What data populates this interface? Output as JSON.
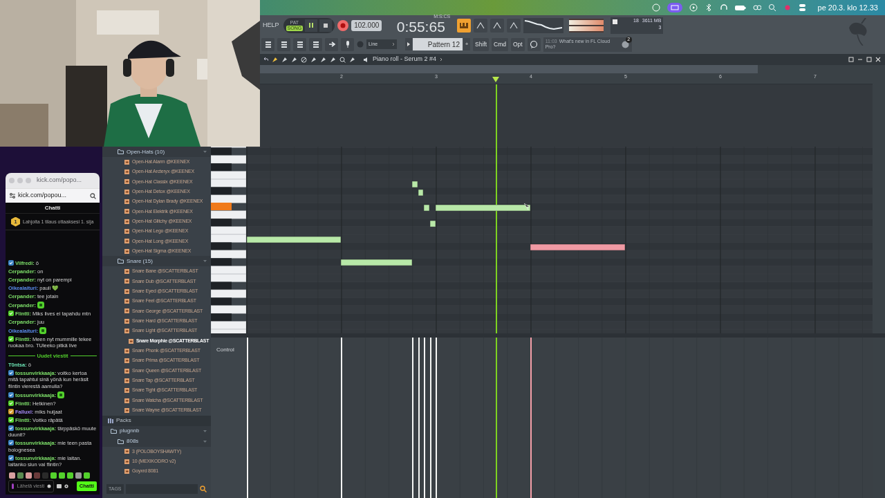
{
  "menubar": {
    "clock": "pe 20.3. klo 12.33"
  },
  "toolbar": {
    "help": "HELP",
    "modes": [
      {
        "label": "PAT",
        "selected": false
      },
      {
        "label": "SONG",
        "selected": true
      }
    ],
    "tempo": "102.000",
    "time": "0:55:65",
    "time_format": "M:S:CS",
    "cpu": "18",
    "memory": "3611 MB",
    "voices": "3",
    "snap": "Line",
    "pattern": "Pattern 12",
    "add": "+",
    "keys": [
      "Shift",
      "Cmd",
      "Opt"
    ],
    "news_time": "11:03",
    "news": "What's new in FL Cloud Pro?",
    "news_badge": "2"
  },
  "browser": {
    "tree": [
      {
        "kind": "folder",
        "label": "Open-Hats (10)",
        "expanded": true,
        "children": [
          {
            "kind": "file",
            "label": "Open-Hat Alarm @KEENEX",
            "selected": false
          },
          {
            "kind": "file",
            "label": "Open-Hat Arcteryx @KEENEX",
            "selected": false
          },
          {
            "kind": "file",
            "label": "Open-Hat Classix @KEENEX",
            "selected": false
          },
          {
            "kind": "file",
            "label": "Open-Hat Detox @KEENEX",
            "selected": false
          },
          {
            "kind": "file",
            "label": "Open-Hat Dylan Brady @KEENEX",
            "selected": false
          },
          {
            "kind": "file",
            "label": "Open-Hat Elektrik @KEENEX",
            "selected": false
          },
          {
            "kind": "file",
            "label": "Open-Hat Glitchy @KEENEX",
            "selected": false
          },
          {
            "kind": "file",
            "label": "Open-Hat Lego @KEENEX",
            "selected": false
          },
          {
            "kind": "file",
            "label": "Open-Hat Long @KEENEX",
            "selected": false
          },
          {
            "kind": "file",
            "label": "Open-Hat Sigma @KEENEX",
            "selected": false
          }
        ]
      },
      {
        "kind": "folder",
        "label": "Snare (15)",
        "expanded": true,
        "children": [
          {
            "kind": "file",
            "label": "Snare Bane  @SCATTERBLAST",
            "selected": false
          },
          {
            "kind": "file",
            "label": "Snare Dub  @SCATTERBLAST",
            "selected": false
          },
          {
            "kind": "file",
            "label": "Snare Eyed  @SCATTERBLAST",
            "selected": false
          },
          {
            "kind": "file",
            "label": "Snare Feel  @SCATTERBLAST",
            "selected": false
          },
          {
            "kind": "file",
            "label": "Snare George  @SCATTERBLAST",
            "selected": false
          },
          {
            "kind": "file",
            "label": "Snare Hard  @SCATTERBLAST",
            "selected": false
          },
          {
            "kind": "file",
            "label": "Snare Light  @SCATTERBLAST",
            "selected": false
          },
          {
            "kind": "file",
            "label": "Snare Morphie  @SCATTERBLAST",
            "selected": true
          },
          {
            "kind": "file",
            "label": "Snare Phonk  @SCATTERBLAST",
            "selected": false
          },
          {
            "kind": "file",
            "label": "Snare Prima  @SCATTERBLAST",
            "selected": false
          },
          {
            "kind": "file",
            "label": "Snare Queen  @SCATTERBLAST",
            "selected": false
          },
          {
            "kind": "file",
            "label": "Snare Tap  @SCATTERBLAST",
            "selected": false
          },
          {
            "kind": "file",
            "label": "Snare Tight  @SCATTERBLAST",
            "selected": false
          },
          {
            "kind": "file",
            "label": "Snare Watcha  @SCATTERBLAST",
            "selected": false
          },
          {
            "kind": "file",
            "label": "Snare Wayne  @SCATTERBLAST",
            "selected": false
          }
        ]
      },
      {
        "kind": "section",
        "label": "Packs",
        "children": [
          {
            "kind": "folder",
            "label": "plugnnb",
            "expanded": true,
            "children": [
              {
                "kind": "folder",
                "label": "808s",
                "expanded": true,
                "children": [
                  {
                    "kind": "file",
                    "label": "3 (POLOBOYSHAWTY)",
                    "selected": false
                  },
                  {
                    "kind": "file",
                    "label": "10 (MEXIKODRO v2)",
                    "selected": false
                  },
                  {
                    "kind": "file",
                    "label": "Goyxrd 8081",
                    "selected": false
                  }
                ]
              }
            ]
          }
        ]
      }
    ],
    "tags": "TAGS"
  },
  "piano_roll": {
    "title": "Piano roll - Serum 2 #4",
    "bars": [
      "2",
      "3",
      "4",
      "5",
      "6",
      "7"
    ],
    "control_label": "Control"
  },
  "chat": {
    "tab_title": "kick.com/popo...",
    "url": "kick.com/popou...",
    "header": "Chatti",
    "pinned_rank": "1",
    "pinned": "Lahjoita 1 tilaus ottaaksesi 1. sija",
    "messages": [
      {
        "kind": "message",
        "badge": {
          "color": "#3b82c4"
        },
        "user": "Vilfredi:",
        "color": "#7ee06a",
        "text": "ö"
      },
      {
        "kind": "message",
        "user": "Cerpander:",
        "color": "#7ee06a",
        "text": "on"
      },
      {
        "kind": "message",
        "user": "Cerpander:",
        "color": "#7ee06a",
        "text": "nyt on parempi"
      },
      {
        "kind": "message",
        "user": "Oikealaituri:",
        "color": "#5b8def",
        "text": "pauli 💚"
      },
      {
        "kind": "message",
        "user": "Cerpander:",
        "color": "#7ee06a",
        "text": "tee jotain"
      },
      {
        "kind": "emote",
        "user": "Cerpander:",
        "color": "#7ee06a"
      },
      {
        "kind": "message",
        "badge": {
          "color": "#53d12c"
        },
        "user": "Flintti:",
        "color": "#7ee06a",
        "text": "Miks lives ei tapahdu mtn"
      },
      {
        "kind": "message",
        "user": "Cerpander:",
        "color": "#7ee06a",
        "text": "juu"
      },
      {
        "kind": "emote",
        "user": "Oikealaituri:",
        "color": "#5b8def"
      },
      {
        "kind": "message",
        "badge": {
          "color": "#53d12c"
        },
        "user": "Flintti:",
        "color": "#7ee06a",
        "text": "Meen nyt mummille tekee ruokaa bro. TUleeko pitkä live"
      },
      {
        "kind": "divider",
        "text": "Uudet viestit"
      },
      {
        "kind": "message",
        "user": "T0ntsa:",
        "color": "#6ee7b7",
        "text": "ö"
      },
      {
        "kind": "message",
        "badge": {
          "color": "#3b82c4"
        },
        "user": "tossunvirkkaaja:",
        "color": "#7ee06a",
        "text": "voitko kertoa mitä tapahtui sinä yönä kun heräsit flintin vierestä aamulla?"
      },
      {
        "kind": "emote",
        "badge": {
          "color": "#3b82c4"
        },
        "user": "tossunvirkkaaja:",
        "color": "#7ee06a"
      },
      {
        "kind": "message",
        "badge": {
          "color": "#53d12c"
        },
        "user": "Flintti:",
        "color": "#7ee06a",
        "text": "Hetkinen?"
      },
      {
        "kind": "message",
        "badge": {
          "color": "#d49a2a"
        },
        "user": "Falluxi:",
        "color": "#a78bfa",
        "text": "miks huijaat"
      },
      {
        "kind": "message",
        "badge": {
          "color": "#53d12c"
        },
        "user": "Flintti:",
        "color": "#7ee06a",
        "text": "Voitko räpätä"
      },
      {
        "kind": "message",
        "badge": {
          "color": "#3b82c4"
        },
        "user": "tossunvirkkaaja:",
        "color": "#7ee06a",
        "text": "tärppäskö muute duunit?"
      },
      {
        "kind": "message",
        "badge": {
          "color": "#3b82c4"
        },
        "user": "tossunvirkkaaja:",
        "color": "#7ee06a",
        "text": "mie teen pasta bolognesea"
      },
      {
        "kind": "message",
        "badge": {
          "color": "#3b82c4"
        },
        "user": "tossunvirkkaaja:",
        "color": "#7ee06a",
        "text": "mie laitan. laitanko siun vai flintin?"
      }
    ],
    "input_placeholder": "Lähetä viesti",
    "send": "Chatti"
  }
}
